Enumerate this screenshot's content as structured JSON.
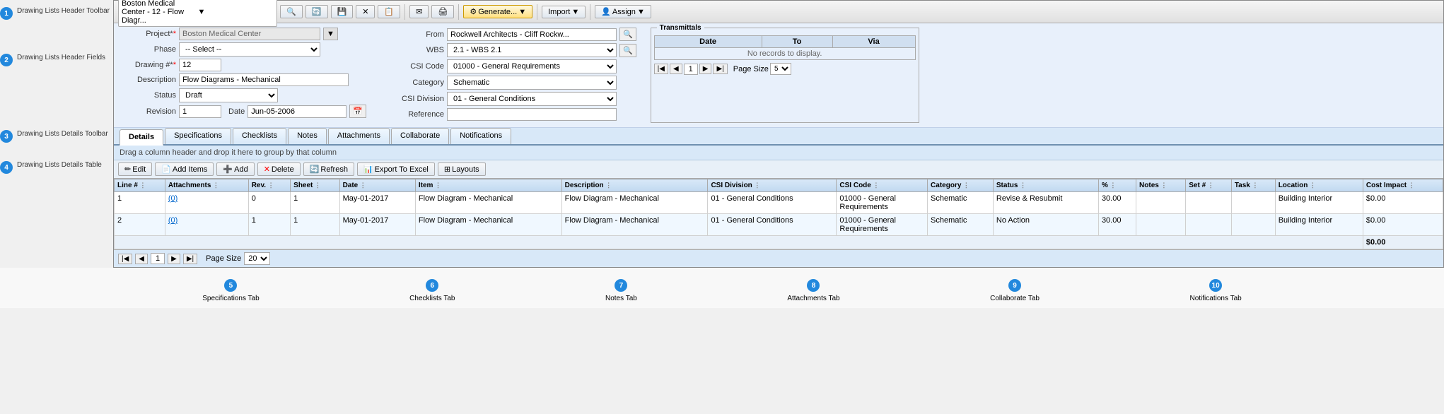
{
  "annotations": {
    "header_toolbar": "Drawing Lists Header Toolbar",
    "header_fields": "Drawing Lists Header Fields",
    "details_toolbar": "Drawing Lists Details Toolbar",
    "details_table": "Drawing Lists Details Table",
    "specs_tab": "Specifications Tab",
    "checklists_tab": "Checklists Tab",
    "notes_tab": "Notes Tab",
    "attachments_tab": "Attachments Tab",
    "collaborate_tab": "Collaborate Tab",
    "notifications_tab": "Notifications Tab"
  },
  "toolbar": {
    "dropdown_label": "Boston Medical Center - 12 - Flow Diagr...",
    "buttons": [
      "search",
      "save",
      "save-as",
      "delete",
      "email",
      "fax",
      "generate",
      "import",
      "assign"
    ],
    "generate_label": "Generate...",
    "import_label": "Import",
    "assign_label": "Assign"
  },
  "header": {
    "project_label": "Project*",
    "project_value": "Boston Medical Center",
    "phase_label": "Phase",
    "phase_value": "-- Select --",
    "drawing_label": "Drawing #*",
    "drawing_value": "12",
    "description_label": "Description",
    "description_value": "Flow Diagrams - Mechanical",
    "status_label": "Status",
    "status_value": "Draft",
    "revision_label": "Revision",
    "revision_value": "1",
    "date_label": "Date",
    "date_value": "Jun-05-2006",
    "from_label": "From",
    "from_value": "Rockwell Architects - Cliff Rockw...",
    "wbs_label": "WBS",
    "wbs_value": "2.1 - WBS 2.1",
    "csi_code_label": "CSI Code",
    "csi_code_value": "01000 - General Requirements",
    "category_label": "Category",
    "category_value": "Schematic",
    "csi_division_label": "CSI Division",
    "csi_division_value": "01 - General Conditions",
    "reference_label": "Reference",
    "reference_value": ""
  },
  "transmittals": {
    "title": "Transmittals",
    "columns": [
      "Date",
      "To",
      "Via"
    ],
    "no_records": "No records to display.",
    "page_size_label": "Page Size",
    "page_size_value": "5"
  },
  "tabs": [
    {
      "id": "details",
      "label": "Details",
      "active": true
    },
    {
      "id": "specifications",
      "label": "Specifications"
    },
    {
      "id": "checklists",
      "label": "Checklists"
    },
    {
      "id": "notes",
      "label": "Notes"
    },
    {
      "id": "attachments",
      "label": "Attachments"
    },
    {
      "id": "collaborate",
      "label": "Collaborate"
    },
    {
      "id": "notifications",
      "label": "Notifications"
    }
  ],
  "group_header": "Drag a column header and drop it here to group by that column",
  "details_toolbar": {
    "edit_label": "Edit",
    "add_items_label": "Add Items",
    "add_label": "Add",
    "delete_label": "Delete",
    "refresh_label": "Refresh",
    "export_label": "Export To Excel",
    "layouts_label": "Layouts"
  },
  "table": {
    "columns": [
      "Line #",
      "Attachments",
      "Rev.",
      "Sheet",
      "Date",
      "Item",
      "Description",
      "CSI Division",
      "CSI Code",
      "Category",
      "Status",
      "% ",
      "Notes",
      "Set #",
      "Task",
      "Location",
      "Cost Impact"
    ],
    "rows": [
      {
        "line": "1",
        "attachments": "(0)",
        "rev": "0",
        "sheet": "1",
        "date": "May-01-2017",
        "item": "Flow Diagram - Mechanical",
        "description": "Flow Diagram - Mechanical",
        "csi_division": "01 - General Conditions",
        "csi_code": "01000 - General Requirements",
        "category": "Schematic",
        "status": "Revise & Resubmit",
        "percent": "30.00",
        "notes": "",
        "set_num": "",
        "task": "",
        "location": "Building Interior",
        "cost_impact": "$0.00"
      },
      {
        "line": "2",
        "attachments": "(0)",
        "rev": "1",
        "sheet": "1",
        "date": "May-01-2017",
        "item": "Flow Diagram - Mechanical",
        "description": "Flow Diagram - Mechanical",
        "csi_division": "01 - General Conditions",
        "csi_code": "01000 - General Requirements",
        "category": "Schematic",
        "status": "No Action",
        "percent": "30.00",
        "notes": "",
        "set_num": "",
        "task": "",
        "location": "Building Interior",
        "cost_impact": "$0.00"
      }
    ],
    "total_cost": "$0.00"
  },
  "pager": {
    "page_size_label": "Page Size",
    "page_size_value": "20",
    "current_page": "1"
  },
  "badge_numbers": {
    "header_toolbar": "1",
    "header_fields": "2",
    "details_toolbar": "3",
    "details_table": "4",
    "specs_tab": "5",
    "checklists_tab": "6",
    "notes_tab": "7",
    "attachments_tab": "8",
    "collaborate_tab": "9",
    "notifications_tab": "10"
  }
}
